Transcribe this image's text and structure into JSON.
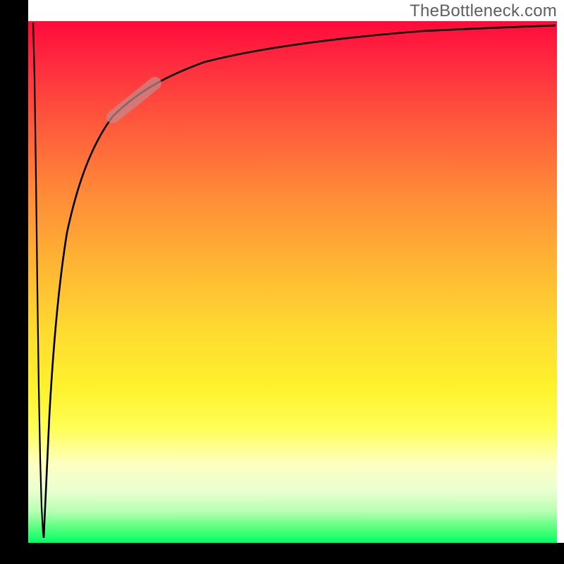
{
  "chart_data": {
    "type": "line",
    "watermark": "TheBottleneck.com",
    "title": "",
    "xlabel": "",
    "ylabel": "",
    "xlim": [
      0,
      100
    ],
    "ylim": [
      0,
      100
    ],
    "gradient_scale_desc": "vertical gradient from red (top, high bottleneck) to green (bottom, low bottleneck)",
    "series": [
      {
        "name": "bottleneck-curve-left",
        "x": [
          0.9,
          1.2,
          1.5,
          1.7,
          2.0,
          2.3,
          2.5,
          2.8,
          2.9
        ],
        "y": [
          99.7,
          89.2,
          70.3,
          48.6,
          29.7,
          16.2,
          6.8,
          2.0,
          0.9
        ]
      },
      {
        "name": "bottleneck-curve-right",
        "x": [
          2.9,
          4.0,
          5.5,
          7.3,
          9.3,
          12.0,
          16.0,
          20.7,
          26.0,
          33.3,
          42.7,
          56.0,
          74.7,
          85.3,
          93.3,
          99.7
        ],
        "y": [
          0.9,
          24.3,
          48.6,
          59.5,
          68.9,
          76.4,
          81.8,
          86.5,
          89.5,
          92.2,
          94.6,
          96.6,
          98.1,
          98.6,
          98.9,
          99.2
        ]
      }
    ],
    "highlight_marker": {
      "color": "#c48a8a",
      "x_range": [
        16.0,
        24.0
      ],
      "y_range": [
        81.6,
        88.1
      ]
    }
  }
}
